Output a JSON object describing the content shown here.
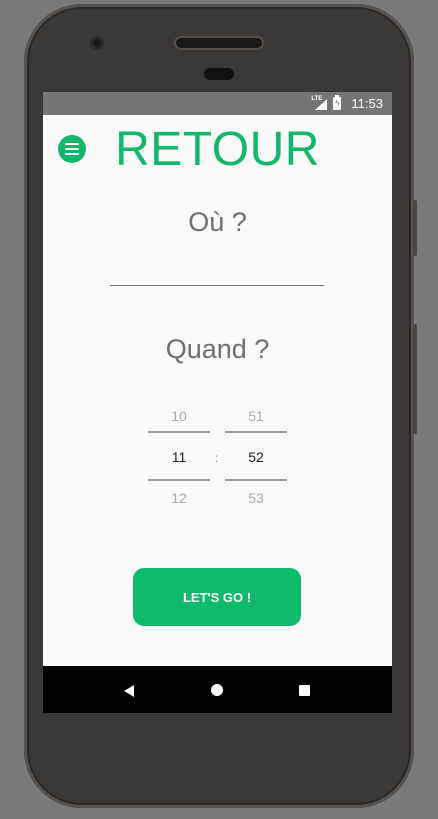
{
  "status_bar": {
    "network": "LTE",
    "time": "11:53"
  },
  "app": {
    "title": "RETOUR"
  },
  "form": {
    "where_label": "Où ?",
    "where_value": "",
    "when_label": "Quand ?",
    "time_picker": {
      "hours": {
        "prev": "10",
        "selected": "11",
        "next": "12"
      },
      "separator": ":",
      "minutes": {
        "prev": "51",
        "selected": "52",
        "next": "53"
      }
    },
    "submit_label": "LET'S GO !"
  },
  "colors": {
    "accent": "#12b76a",
    "button": "#0dbb6a",
    "status_bar": "#757575"
  }
}
